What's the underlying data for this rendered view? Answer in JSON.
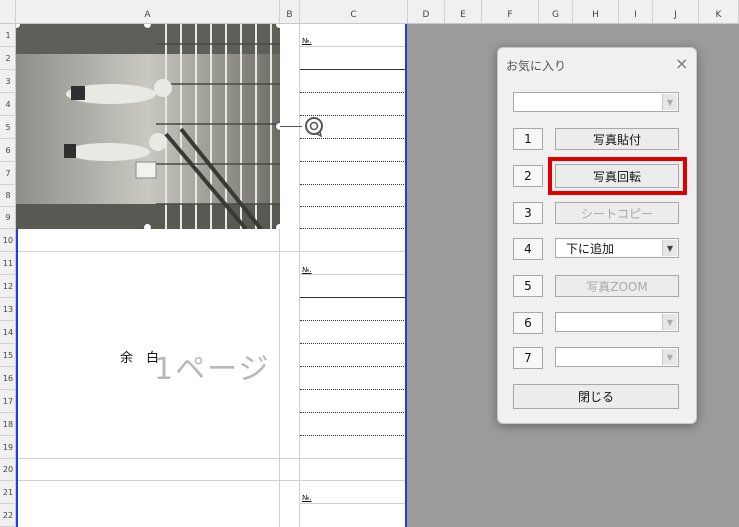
{
  "columns": [
    "A",
    "B",
    "C",
    "D",
    "E",
    "F",
    "G",
    "H",
    "I",
    "J",
    "K"
  ],
  "rows": [
    "1",
    "2",
    "3",
    "4",
    "5",
    "6",
    "7",
    "8",
    "9",
    "10",
    "11",
    "12",
    "13",
    "14",
    "15",
    "16",
    "17",
    "18",
    "19",
    "20",
    "21",
    "22"
  ],
  "sheet": {
    "field_labels": [
      "№.",
      "№.",
      "№."
    ],
    "margin_text": "余　白",
    "watermark": "1ページ"
  },
  "dialog": {
    "title": "お気に入り",
    "close": "×",
    "top_combo_value": "",
    "rows": [
      {
        "num": "1",
        "label": "写真貼付",
        "type": "button",
        "enabled": true
      },
      {
        "num": "2",
        "label": "写真回転",
        "type": "button",
        "enabled": true,
        "highlighted": true
      },
      {
        "num": "3",
        "label": "シートコピー",
        "type": "button",
        "enabled": false
      },
      {
        "num": "4",
        "label": "下に追加",
        "type": "combo",
        "enabled": true
      },
      {
        "num": "5",
        "label": "写真ZOOM",
        "type": "button",
        "enabled": false
      },
      {
        "num": "6",
        "label": "",
        "type": "combo",
        "enabled": false
      },
      {
        "num": "7",
        "label": "",
        "type": "combo",
        "enabled": false
      }
    ],
    "close_button": "閉じる"
  },
  "colors": {
    "highlight": "#e00000",
    "page_border": "#1f3fd8",
    "background": "#9b9b9b"
  }
}
